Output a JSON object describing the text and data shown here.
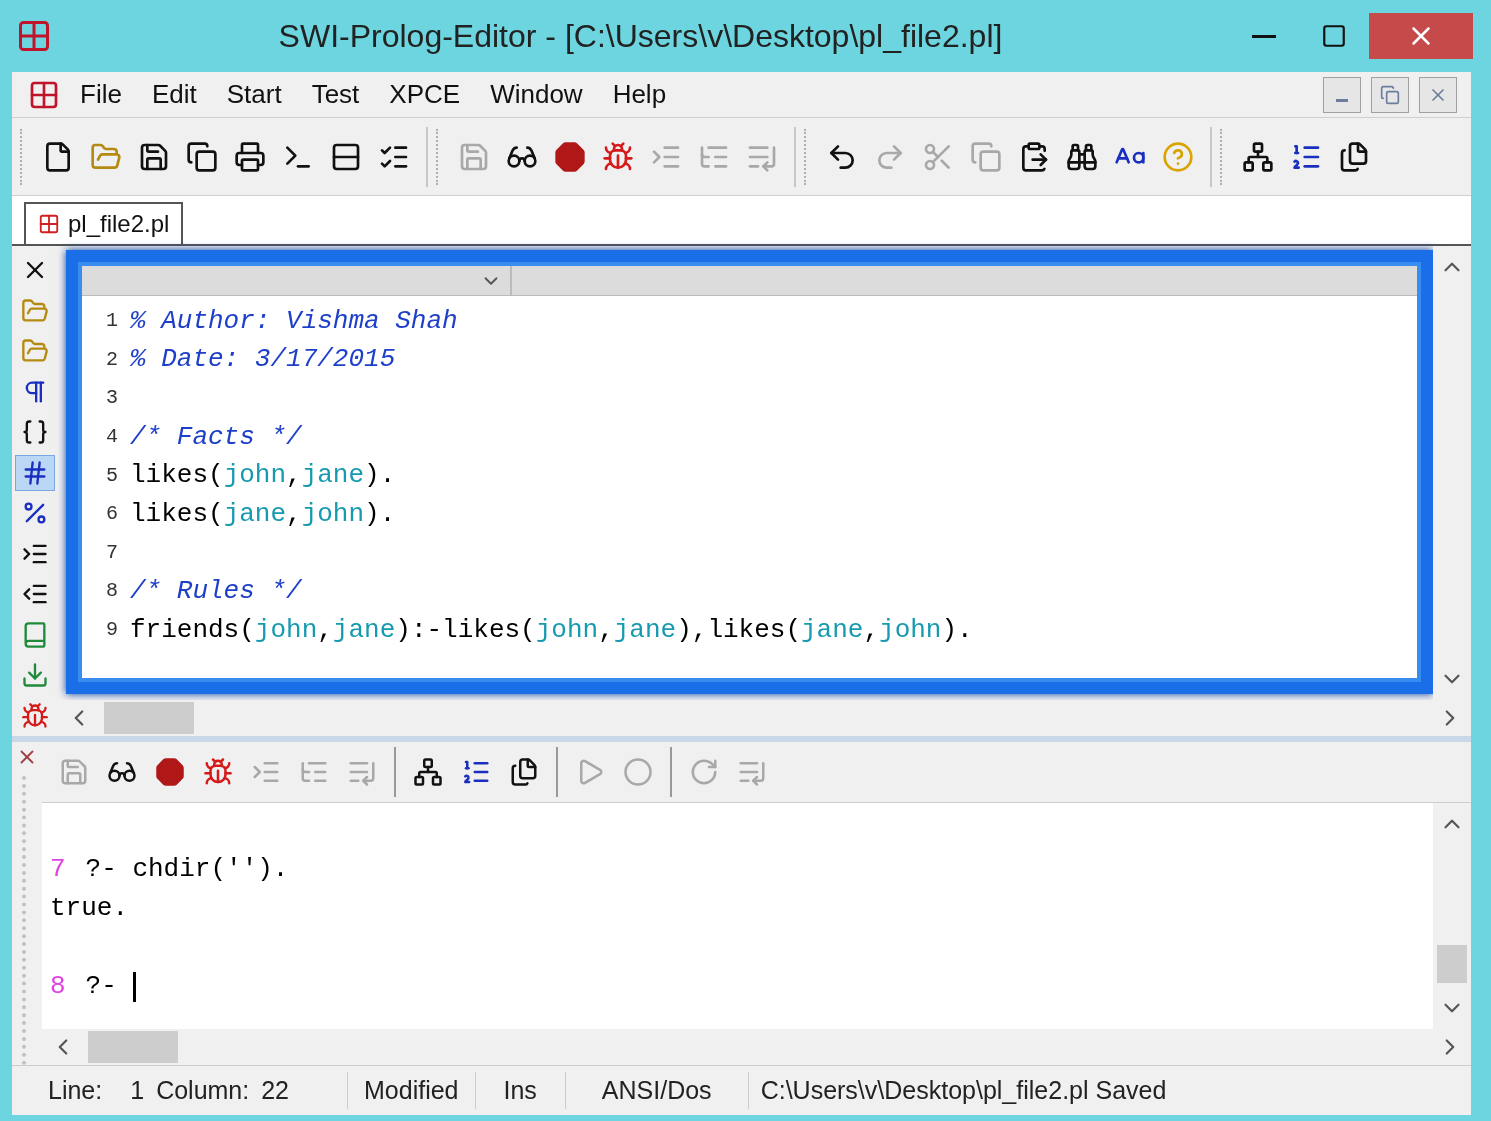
{
  "window": {
    "title": "SWI-Prolog-Editor - [C:\\Users\\v\\Desktop\\pl_file2.pl]"
  },
  "menu": [
    "File",
    "Edit",
    "Start",
    "Test",
    "XPCE",
    "Window",
    "Help"
  ],
  "toolbar": [
    [
      {
        "disabled": false
      },
      {
        "disabled": false
      },
      {
        "disabled": false
      },
      {
        "disabled": false
      },
      {
        "disabled": false
      },
      {
        "disabled": false
      },
      {
        "disabled": false
      },
      {
        "disabled": false
      }
    ],
    [
      {
        "disabled": true
      },
      {
        "disabled": false
      },
      {
        "disabled": false
      },
      {
        "disabled": false
      },
      {
        "disabled": true
      },
      {
        "disabled": true
      },
      {
        "disabled": true
      }
    ],
    [
      {
        "disabled": false
      },
      {
        "disabled": true
      },
      {
        "disabled": true
      },
      {
        "disabled": true
      },
      {
        "disabled": false
      },
      {
        "disabled": false
      },
      {
        "disabled": false
      },
      {
        "disabled": false
      }
    ],
    [
      {
        "disabled": false
      },
      {
        "disabled": false
      },
      {
        "disabled": false
      }
    ]
  ],
  "tabs": [
    {
      "label": "pl_file2.pl",
      "selected": true
    }
  ],
  "side_tools": [
    {
      "selected": false
    },
    {
      "selected": false
    },
    {
      "selected": false
    },
    {
      "selected": false
    },
    {
      "selected": false
    },
    {
      "selected": true
    },
    {
      "selected": false
    },
    {
      "selected": false
    },
    {
      "selected": false
    },
    {
      "selected": false
    },
    {
      "selected": false
    },
    {
      "selected": false
    }
  ],
  "editor": {
    "lines": [
      {
        "number": "1",
        "tokens": [
          {
            "kind": "comment",
            "text": "% Author: Vishma Shah"
          }
        ]
      },
      {
        "number": "2",
        "tokens": [
          {
            "kind": "comment",
            "text": "% Date: 3/17/2015"
          }
        ]
      },
      {
        "number": "3"
      },
      {
        "number": "4",
        "tokens": [
          {
            "kind": "comment",
            "text": "/* Facts */"
          }
        ]
      },
      {
        "number": "5",
        "tokens": [
          {
            "kind": "plain",
            "text": "likes("
          },
          {
            "kind": "atom",
            "text": "john"
          },
          {
            "kind": "plain",
            "text": ","
          },
          {
            "kind": "atom",
            "text": "jane"
          },
          {
            "kind": "plain",
            "text": ")."
          }
        ]
      },
      {
        "number": "6",
        "tokens": [
          {
            "kind": "plain",
            "text": "likes("
          },
          {
            "kind": "atom",
            "text": "jane"
          },
          {
            "kind": "plain",
            "text": ","
          },
          {
            "kind": "atom",
            "text": "john"
          },
          {
            "kind": "plain",
            "text": ")."
          }
        ]
      },
      {
        "number": "7"
      },
      {
        "number": "8",
        "tokens": [
          {
            "kind": "comment",
            "text": "/* Rules */"
          }
        ]
      },
      {
        "number": "9",
        "tokens": [
          {
            "kind": "plain",
            "text": "friends("
          },
          {
            "kind": "atom",
            "text": "john"
          },
          {
            "kind": "plain",
            "text": ","
          },
          {
            "kind": "atom",
            "text": "jane"
          },
          {
            "kind": "plain",
            "text": "):-likes("
          },
          {
            "kind": "atom",
            "text": "john"
          },
          {
            "kind": "plain",
            "text": ","
          },
          {
            "kind": "atom",
            "text": "jane"
          },
          {
            "kind": "plain",
            "text": "),likes("
          },
          {
            "kind": "atom",
            "text": "jane"
          },
          {
            "kind": "plain",
            "text": ","
          },
          {
            "kind": "atom",
            "text": "john"
          },
          {
            "kind": "plain",
            "text": ")."
          }
        ]
      }
    ]
  },
  "console": {
    "toolbar": [
      {
        "disabled": true
      },
      {
        "disabled": false
      },
      {
        "disabled": false
      },
      {
        "disabled": false
      },
      {
        "disabled": true
      },
      {
        "disabled": true
      },
      {
        "disabled": true
      },
      {
        "disabled": false
      },
      {
        "disabled": false
      },
      {
        "disabled": false
      },
      {
        "disabled": true
      },
      {
        "disabled": true
      },
      {
        "disabled": true
      },
      {
        "disabled": true
      }
    ],
    "lines": [
      {
        "kind": "blank"
      },
      {
        "kind": "query",
        "number": "7",
        "text": "?- chdir('')."
      },
      {
        "kind": "output",
        "text": "true."
      },
      {
        "kind": "blank"
      },
      {
        "kind": "prompt",
        "number": "8",
        "text": "?-"
      }
    ]
  },
  "status_bar": {
    "line_label": "Line:",
    "line": "1",
    "column_label": "Column:",
    "column": "22",
    "modified": "Modified",
    "mode": "Ins",
    "encoding": "ANSI/Dos",
    "message": "C:\\Users\\v\\Desktop\\pl_file2.pl Saved"
  }
}
